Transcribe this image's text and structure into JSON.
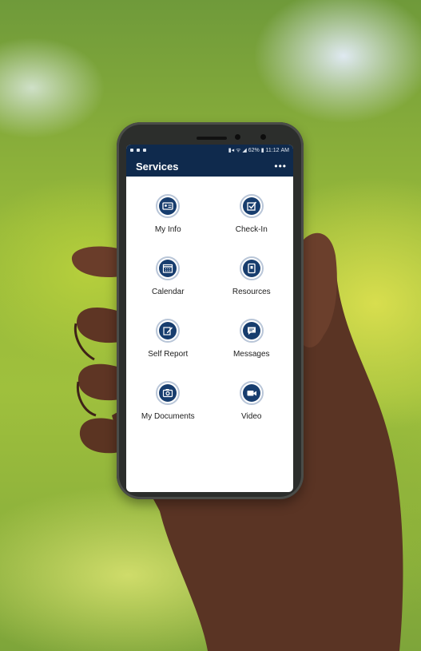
{
  "status_bar": {
    "battery": "62%",
    "time": "11:12 AM"
  },
  "app_bar": {
    "title": "Services",
    "more_label": "•••"
  },
  "services": [
    {
      "label": "My Info",
      "icon": "id-card-icon"
    },
    {
      "label": "Check-In",
      "icon": "checkbox-icon"
    },
    {
      "label": "Calendar",
      "icon": "calendar-icon"
    },
    {
      "label": "Resources",
      "icon": "book-icon"
    },
    {
      "label": "Self Report",
      "icon": "edit-report-icon"
    },
    {
      "label": "Messages",
      "icon": "chat-icon"
    },
    {
      "label": "My Documents",
      "icon": "camera-document-icon"
    },
    {
      "label": "Video",
      "icon": "video-camera-icon"
    }
  ],
  "colors": {
    "header": "#0f2a4d",
    "icon": "#173d6e",
    "icon_ring": "#b9c6d8"
  }
}
